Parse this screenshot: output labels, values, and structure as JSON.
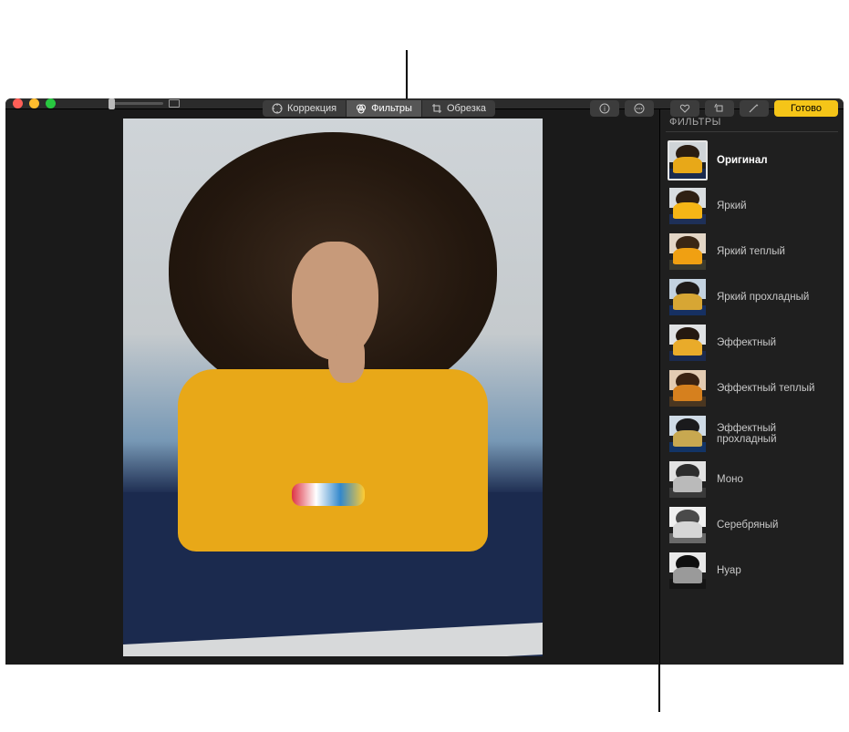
{
  "toolbar": {
    "adjust_label": "Коррекция",
    "filters_label": "Фильтры",
    "crop_label": "Обрезка",
    "done_label": "Готово"
  },
  "sidebar": {
    "title": "ФИЛЬТРЫ",
    "filters": [
      {
        "label": "Оригинал",
        "body_color": "#e8a818",
        "sky_color": "#cfd4d8",
        "hair_color": "#2a1c11",
        "cloth_color": "#1b2a4e",
        "selected": true
      },
      {
        "label": "Яркий",
        "body_color": "#f5b516",
        "sky_color": "#d9dde0",
        "hair_color": "#2f2013",
        "cloth_color": "#1e3058",
        "selected": false
      },
      {
        "label": "Яркий теплый",
        "body_color": "#f0a012",
        "sky_color": "#e3d6c6",
        "hair_color": "#3a2614",
        "cloth_color": "#3a3a2f",
        "selected": false
      },
      {
        "label": "Яркий прохладный",
        "body_color": "#d7a634",
        "sky_color": "#c3d2e0",
        "hair_color": "#1e1a18",
        "cloth_color": "#163062",
        "selected": false
      },
      {
        "label": "Эффектный",
        "body_color": "#e9ab2a",
        "sky_color": "#e0e2e4",
        "hair_color": "#241810",
        "cloth_color": "#1b2a4e",
        "selected": false
      },
      {
        "label": "Эффектный теплый",
        "body_color": "#d6801e",
        "sky_color": "#e3cbb2",
        "hair_color": "#3a2212",
        "cloth_color": "#4a3620",
        "selected": false
      },
      {
        "label": "Эффектный прохладный",
        "body_color": "#c8a850",
        "sky_color": "#cfdbe6",
        "hair_color": "#1a1a1c",
        "cloth_color": "#123466",
        "selected": false
      },
      {
        "label": "Моно",
        "body_color": "#bababa",
        "sky_color": "#e2e2e2",
        "hair_color": "#2c2c2c",
        "cloth_color": "#3a3a3a",
        "selected": false
      },
      {
        "label": "Серебряный",
        "body_color": "#d6d6d6",
        "sky_color": "#f0f0f0",
        "hair_color": "#4a4a4a",
        "cloth_color": "#6a6a6a",
        "selected": false
      },
      {
        "label": "Нуар",
        "body_color": "#9a9a9a",
        "sky_color": "#e8e8e8",
        "hair_color": "#0e0e0e",
        "cloth_color": "#151515",
        "selected": false
      }
    ]
  }
}
